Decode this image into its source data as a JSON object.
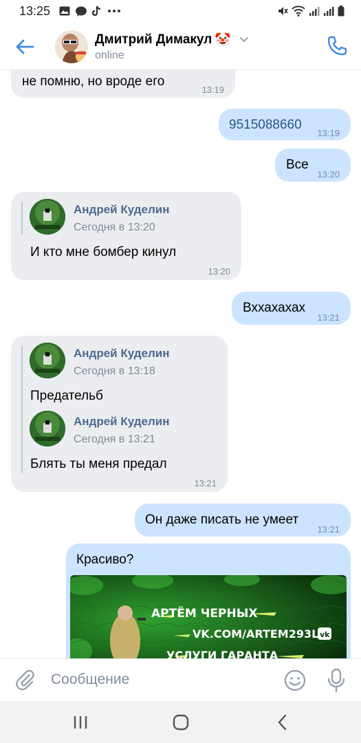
{
  "status_bar": {
    "time": "13:25"
  },
  "header": {
    "name": "Дмитрий Димакул",
    "emoji": "🤡",
    "status": "online"
  },
  "messages": [
    {
      "type": "in",
      "text": "не помню, но вроде его",
      "time": "13:19"
    },
    {
      "type": "out",
      "text": "9515088660",
      "time": "13:19"
    },
    {
      "type": "out",
      "text": "Все",
      "time": "13:20"
    },
    {
      "type": "in_forward",
      "author": "Андрей Куделин",
      "date": "Сегодня в 13:20",
      "text": "И кто мне бомбер кинул",
      "time": "13:20"
    },
    {
      "type": "out",
      "text": "Вххахахах",
      "time": "13:21"
    },
    {
      "type": "in_forward2",
      "forwards": [
        {
          "author": "Андрей Куделин",
          "date": "Сегодня в 13:18",
          "text": "Предательб"
        },
        {
          "author": "Андрей Куделин",
          "date": "Сегодня в 13:21",
          "text": "Блять ты меня предал"
        }
      ],
      "time": "13:21"
    },
    {
      "type": "out",
      "text": "Он даже писать не умеет",
      "time": "13:21"
    },
    {
      "type": "out_image",
      "text": "Красиво?",
      "banner_lines": [
        "АРТЁМ ЧЕРНЫХ",
        "VK.COM/ARTEM293LL",
        "УСЛУГИ ГАРАНТА"
      ]
    }
  ],
  "composer": {
    "placeholder": "Сообщение"
  },
  "colors": {
    "accent": "#3f8ae0",
    "bubble_out": "#cce4ff",
    "bubble_in": "#ebedf0",
    "author": "#4e6a8f"
  }
}
